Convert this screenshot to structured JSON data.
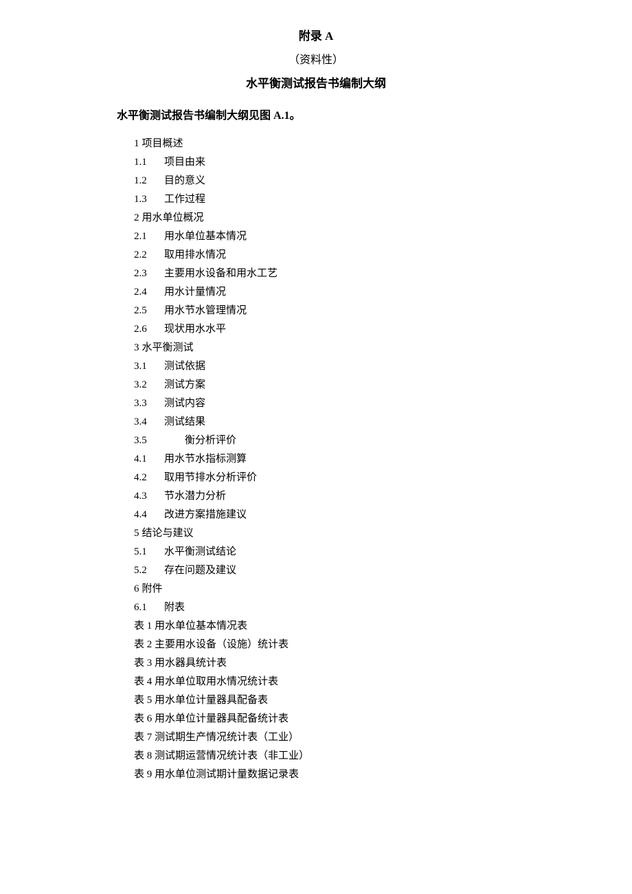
{
  "header": {
    "appendix_title": "附录 A",
    "appendix_type": "（资料性）",
    "main_title": "水平衡测试报告书编制大纲"
  },
  "intro": "水平衡测试报告书编制大纲见图 A.1。",
  "outline": {
    "s1": {
      "num": "1",
      "title": "项目概述"
    },
    "s1_1": {
      "num": "1.1",
      "title": "项目由来"
    },
    "s1_2": {
      "num": "1.2",
      "title": "目的意义"
    },
    "s1_3": {
      "num": "1.3",
      "title": "工作过程"
    },
    "s2": {
      "num": "2",
      "title": "用水单位概况"
    },
    "s2_1": {
      "num": "2.1",
      "title": "用水单位基本情况"
    },
    "s2_2": {
      "num": "2.2",
      "title": "取用排水情况"
    },
    "s2_3": {
      "num": "2.3",
      "title": "主要用水设备和用水工艺"
    },
    "s2_4": {
      "num": "2.4",
      "title": "用水计量情况"
    },
    "s2_5": {
      "num": "2.5",
      "title": "用水节水管理情况"
    },
    "s2_6": {
      "num": "2.6",
      "title": "现状用水水平"
    },
    "s3": {
      "num": "3",
      "title": "水平衡测试"
    },
    "s3_1": {
      "num": "3.1",
      "title": "测试依据"
    },
    "s3_2": {
      "num": "3.2",
      "title": "测试方案"
    },
    "s3_3": {
      "num": "3.3",
      "title": "测试内容"
    },
    "s3_4": {
      "num": "3.4",
      "title": "测试结果"
    },
    "s3_5": {
      "num": "3.5",
      "title": "　　衡分析评价"
    },
    "s4_1": {
      "num": "4.1",
      "title": "用水节水指标测算"
    },
    "s4_2": {
      "num": "4.2",
      "title": "取用节排水分析评价"
    },
    "s4_3": {
      "num": "4.3",
      "title": "节水潜力分析"
    },
    "s4_4": {
      "num": "4.4",
      "title": "改进方案措施建议"
    },
    "s5": {
      "num": "5",
      "title": "结论与建议"
    },
    "s5_1": {
      "num": "5.1",
      "title": "水平衡测试结论"
    },
    "s5_2": {
      "num": "5.2",
      "title": "存在问题及建议"
    },
    "s6": {
      "num": "6",
      "title": "附件"
    },
    "s6_1": {
      "num": "6.1",
      "title": "附表"
    },
    "t1": "表 1 用水单位基本情况表",
    "t2": "表 2 主要用水设备（设施）统计表",
    "t3": "表 3 用水器具统计表",
    "t4": "表 4 用水单位取用水情况统计表",
    "t5": "表 5 用水单位计量器具配备表",
    "t6": "表 6 用水单位计量器具配备统计表",
    "t7": "表 7 测试期生产情况统计表（工业）",
    "t8": "表 8 测试期运营情况统计表（非工业）",
    "t9": "表 9 用水单位测试期计量数据记录表"
  }
}
